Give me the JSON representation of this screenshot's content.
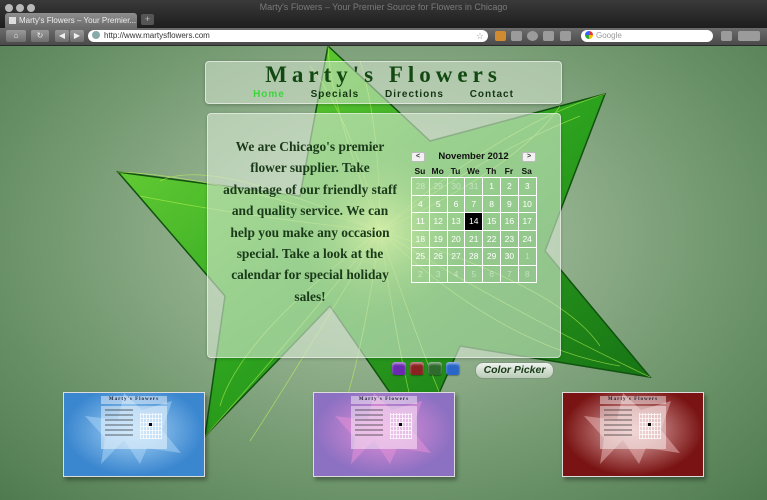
{
  "browser": {
    "window_title": "Marty's Flowers – Your Premier Source for Flowers in Chicago",
    "tab_title": "Marty's Flowers – Your Premier...",
    "url": "http://www.martysflowers.com",
    "search_placeholder": "Google"
  },
  "site": {
    "title": "Marty's Flowers",
    "nav": [
      {
        "label": "Home",
        "active": true
      },
      {
        "label": "Specials",
        "active": false
      },
      {
        "label": "Directions",
        "active": false
      },
      {
        "label": "Contact",
        "active": false
      }
    ],
    "intro_text": "We are Chicago's premier flower supplier. Take advantage of our friendly staff and quality service. We can help you make any occasion special. Take a look at the calendar for special holiday sales!"
  },
  "calendar": {
    "month_label": "November 2012",
    "prev_label": "<",
    "next_label": ">",
    "weekdays": [
      "Su",
      "Mo",
      "Tu",
      "We",
      "Th",
      "Fr",
      "Sa"
    ],
    "weeks": [
      [
        {
          "d": "28",
          "o": true
        },
        {
          "d": "29",
          "o": true
        },
        {
          "d": "30",
          "o": true
        },
        {
          "d": "31",
          "o": true
        },
        {
          "d": "1"
        },
        {
          "d": "2"
        },
        {
          "d": "3"
        }
      ],
      [
        {
          "d": "4"
        },
        {
          "d": "5"
        },
        {
          "d": "6"
        },
        {
          "d": "7"
        },
        {
          "d": "8"
        },
        {
          "d": "9"
        },
        {
          "d": "10"
        }
      ],
      [
        {
          "d": "11"
        },
        {
          "d": "12"
        },
        {
          "d": "13"
        },
        {
          "d": "14",
          "t": true
        },
        {
          "d": "15"
        },
        {
          "d": "16"
        },
        {
          "d": "17"
        }
      ],
      [
        {
          "d": "18"
        },
        {
          "d": "19"
        },
        {
          "d": "20"
        },
        {
          "d": "21"
        },
        {
          "d": "22"
        },
        {
          "d": "23"
        },
        {
          "d": "24"
        }
      ],
      [
        {
          "d": "25"
        },
        {
          "d": "26"
        },
        {
          "d": "27"
        },
        {
          "d": "28"
        },
        {
          "d": "29"
        },
        {
          "d": "30"
        },
        {
          "d": "1",
          "o": true
        }
      ],
      [
        {
          "d": "2",
          "o": true
        },
        {
          "d": "3",
          "o": true
        },
        {
          "d": "4",
          "o": true
        },
        {
          "d": "5",
          "o": true
        },
        {
          "d": "6",
          "o": true
        },
        {
          "d": "7",
          "o": true
        },
        {
          "d": "8",
          "o": true
        }
      ]
    ]
  },
  "color_picker": {
    "label": "Color Picker",
    "swatches": [
      {
        "name": "purple",
        "color": "#6a2ab0"
      },
      {
        "name": "red",
        "color": "#8a2222"
      },
      {
        "name": "green",
        "color": "#2f6a2f"
      },
      {
        "name": "blue",
        "color": "#2a66c8"
      }
    ]
  },
  "previews": [
    {
      "name": "blue-theme",
      "bg": "#3a86cf",
      "accent": "#a8d4f6",
      "title": "Marty's Flowers"
    },
    {
      "name": "purple-theme",
      "bg": "#8c70c2",
      "accent": "#e38fd7",
      "title": "Marty's Flowers"
    },
    {
      "name": "red-theme",
      "bg": "#7a1414",
      "accent": "#e6b3b3",
      "title": "Marty's Flowers"
    }
  ],
  "colors": {
    "title_green": "#124812",
    "nav_active": "#3cd63c",
    "star_green": "#2a8a1a"
  }
}
